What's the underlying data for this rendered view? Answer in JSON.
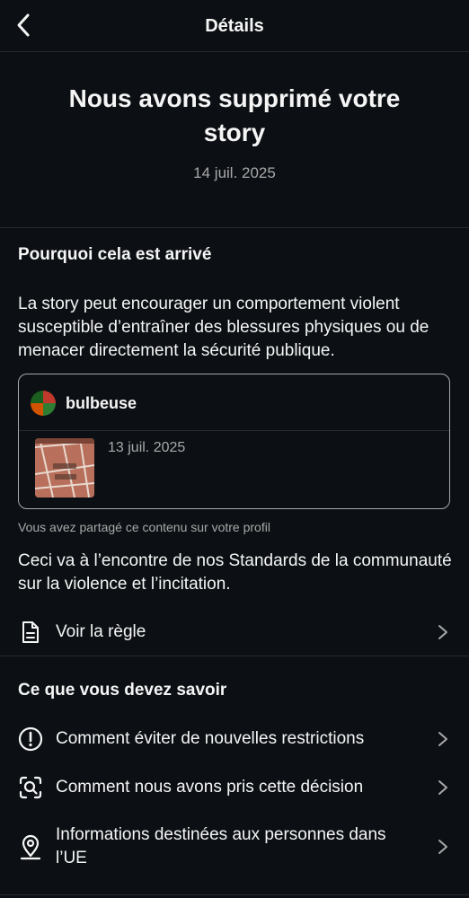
{
  "header": {
    "title": "Détails",
    "back_icon": "chevron-left-icon"
  },
  "hero": {
    "title": "Nous avons supprimé votre story",
    "date": "14 juil. 2025"
  },
  "why": {
    "title": "Pourquoi cela est arrivé",
    "description": "La story peut encourager un comportement violent susceptible d’entraîner des blessures physiques ou de menacer directement la sécurité publique.",
    "card": {
      "username": "bulbeuse",
      "date": "13 juil. 2025"
    },
    "caption": "Vous avez partagé ce contenu sur votre profil",
    "rule_text": "Ceci va à l’encontre de nos Standards de la communauté sur la violence et l’incitation.",
    "rule_link": "Voir la règle"
  },
  "know": {
    "title": "Ce que vous devez savoir",
    "items": [
      {
        "label": "Comment éviter de nouvelles restrictions",
        "icon": "alert-circle-icon"
      },
      {
        "label": "Comment nous avons pris cette décision",
        "icon": "scan-search-icon"
      },
      {
        "label": "Informations destinées aux personnes dans l’UE",
        "icon": "location-pin-icon"
      }
    ]
  },
  "colors": {
    "background": "#0c1014",
    "text": "#f5f5f5",
    "muted": "#a8a8a8",
    "divider": "#262a2e"
  }
}
